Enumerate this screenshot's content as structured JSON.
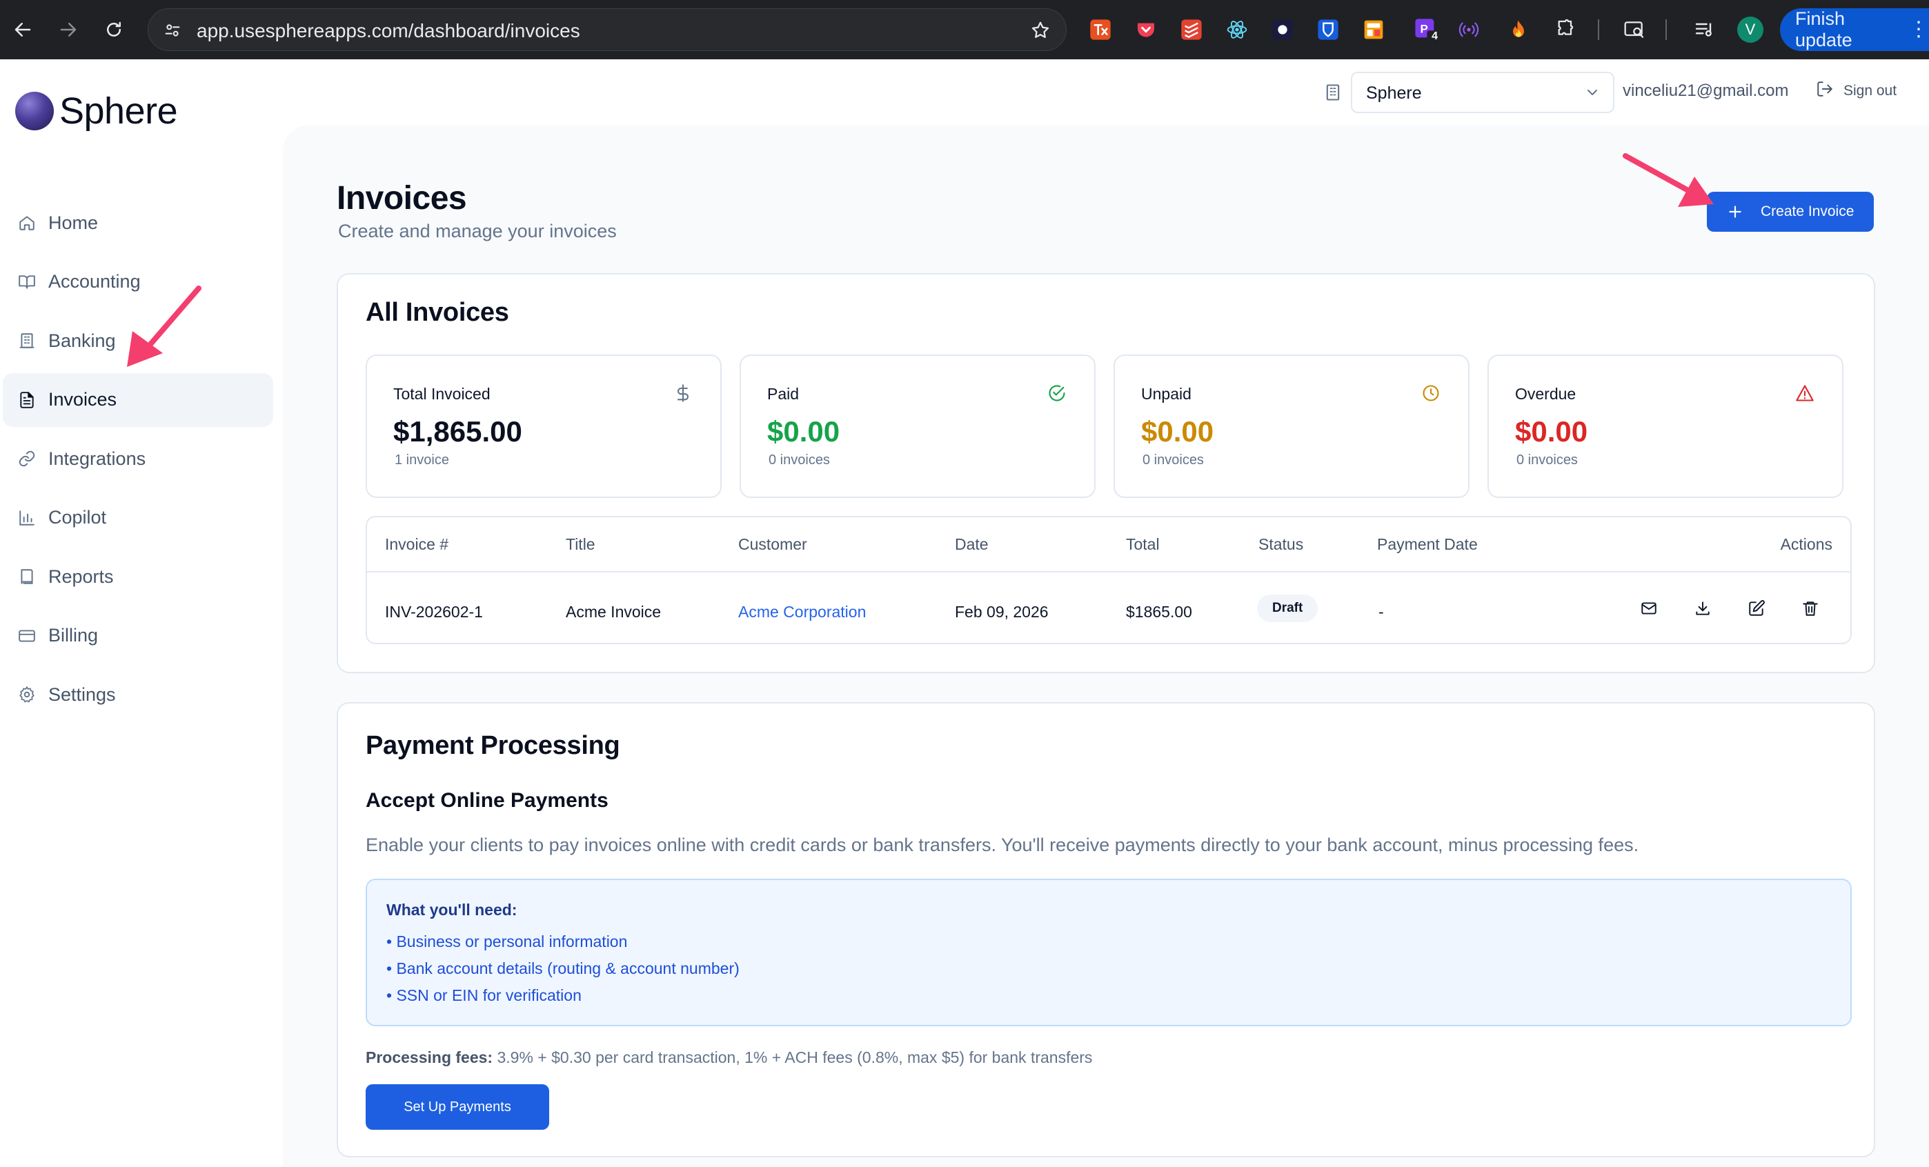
{
  "browser": {
    "url": "app.usesphereapps.com/dashboard/invoices",
    "profile_initial": "V",
    "finish_update_label": "Finish update",
    "extension_badge": "4"
  },
  "sidebar": {
    "logo_text": "Sphere",
    "items": [
      {
        "label": "Home",
        "icon": "home-icon"
      },
      {
        "label": "Accounting",
        "icon": "book-icon"
      },
      {
        "label": "Banking",
        "icon": "bank-icon"
      },
      {
        "label": "Invoices",
        "icon": "file-text-icon",
        "active": true
      },
      {
        "label": "Integrations",
        "icon": "link-icon"
      },
      {
        "label": "Copilot",
        "icon": "bar-chart-icon"
      },
      {
        "label": "Reports",
        "icon": "notebook-icon"
      },
      {
        "label": "Billing",
        "icon": "credit-card-icon"
      },
      {
        "label": "Settings",
        "icon": "gear-icon"
      }
    ]
  },
  "header": {
    "org_select_value": "Sphere",
    "email": "vinceliu21@gmail.com",
    "sign_out_label": "Sign out"
  },
  "page": {
    "title": "Invoices",
    "subtitle": "Create and manage your invoices",
    "create_button_label": "Create Invoice"
  },
  "all_invoices": {
    "title": "All Invoices",
    "stats": [
      {
        "label": "Total Invoiced",
        "value": "$1,865.00",
        "sub": "1 invoice",
        "color": "#0b1020",
        "icon": "dollar-icon"
      },
      {
        "label": "Paid",
        "value": "$0.00",
        "sub": "0 invoices",
        "color": "#16a34a",
        "icon": "check-circle-icon"
      },
      {
        "label": "Unpaid",
        "value": "$0.00",
        "sub": "0 invoices",
        "color": "#ca8a04",
        "icon": "clock-icon"
      },
      {
        "label": "Overdue",
        "value": "$0.00",
        "sub": "0 invoices",
        "color": "#dc2626",
        "icon": "alert-triangle-icon"
      }
    ],
    "table": {
      "columns": [
        "Invoice #",
        "Title",
        "Customer",
        "Date",
        "Total",
        "Status",
        "Payment Date",
        "Actions"
      ],
      "rows": [
        {
          "invoice": "INV-202602-1",
          "title": "Acme Invoice",
          "customer": "Acme Corporation",
          "date": "Feb 09, 2026",
          "total": "$1865.00",
          "status": "Draft",
          "payment_date": "-"
        }
      ]
    }
  },
  "payment_processing": {
    "title": "Payment Processing",
    "subtitle": "Accept Online Payments",
    "description": "Enable your clients to pay invoices online with credit cards or bank transfers. You'll receive payments directly to your bank account, minus processing fees.",
    "needs_title": "What you'll need:",
    "needs": [
      "• Business or personal information",
      "• Bank account details (routing & account number)",
      "• SSN or EIN for verification"
    ],
    "fees_label": "Processing fees:",
    "fees_text": " 3.9% + $0.30 per card transaction, 1% + ACH fees (0.8%, max $5) for bank transfers",
    "setup_button_label": "Set Up Payments"
  },
  "colors": {
    "accent": "#1d5fe0",
    "annotation_arrow": "#f43f6e"
  }
}
